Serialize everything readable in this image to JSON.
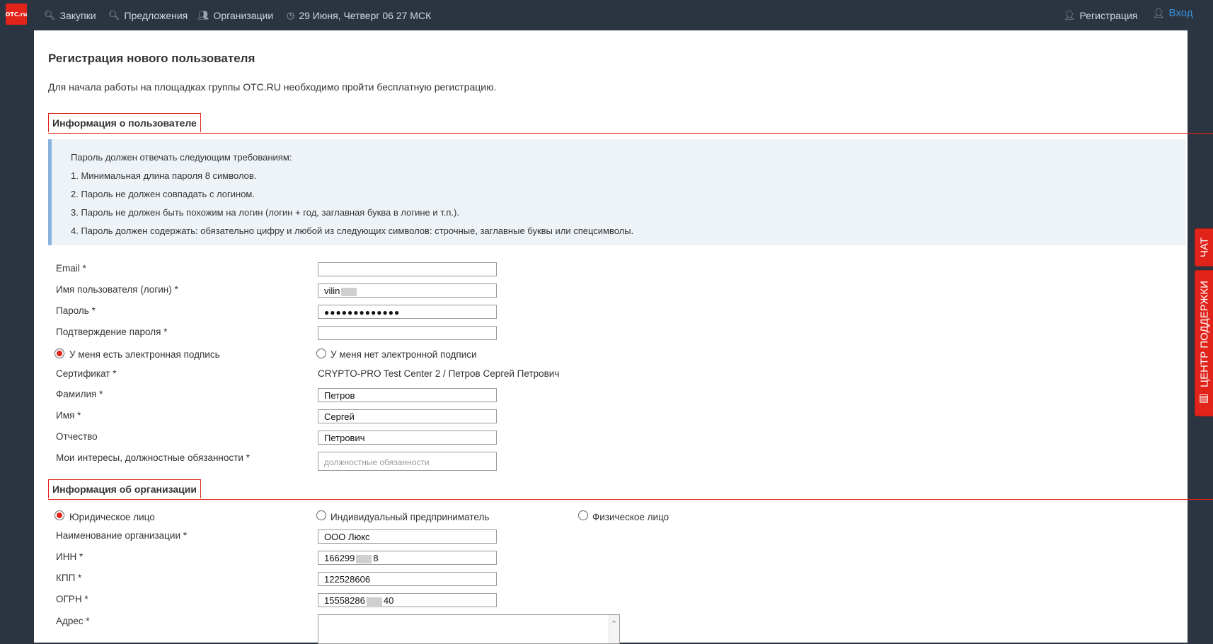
{
  "topbar": {
    "logo": "OTC.ru",
    "nav": [
      {
        "icon": "search-icon",
        "label": "Закупки"
      },
      {
        "icon": "search-icon",
        "label": "Предложения"
      },
      {
        "icon": "users-icon",
        "label": "Организации"
      },
      {
        "icon": "clock-icon",
        "label": "29 Июня, Четверг 06 27 МСК"
      }
    ],
    "register": {
      "icon": "user-plus-icon",
      "label": "Регистрация"
    },
    "login": {
      "icon": "user-icon",
      "label": "Вход"
    }
  },
  "page": {
    "title": "Регистрация нового пользователя",
    "intro": "Для начала работы на площадках группы OTC.RU необходимо пройти бесплатную регистрацию."
  },
  "user_section": {
    "header": "Информация о пользователе",
    "hint": {
      "lead": "Пароль должен отвечать следующим требованиям:",
      "items": [
        "1. Минимальная длина пароля 8 символов.",
        "2. Пароль не должен совпадать с логином.",
        "3. Пароль не должен быть похожим на логин (логин + год, заглавная буква в логине и т.п.).",
        "4. Пароль должен содержать: обязательно цифру и любой из следующих символов: строчные, заглавные буквы или спецсимволы."
      ]
    },
    "email": {
      "label": "Email *",
      "value": ""
    },
    "login": {
      "label": "Имя пользователя (логин) *",
      "value": "vilin"
    },
    "password": {
      "label": "Пароль *",
      "value": "●●●●●●●●●●●●●"
    },
    "password_confirm": {
      "label": "Подтверждение пароля *",
      "value": ""
    },
    "signature_yes": "У меня есть электронная подпись",
    "signature_no": "У меня нет электронной подписи",
    "certificate": {
      "label": "Сертификат *",
      "value": "CRYPTO-PRO Test Center 2 / Петров Сергей Петрович"
    },
    "last_name": {
      "label": "Фамилия *",
      "value": "Петров"
    },
    "first_name": {
      "label": "Имя *",
      "value": "Сергей"
    },
    "middle_name": {
      "label": "Отчество",
      "value": "Петрович"
    },
    "interests": {
      "label": "Мои интересы, должностные обязанности *",
      "placeholder": "должностные обязанности"
    }
  },
  "org_section": {
    "header": "Информация об организации",
    "type_legal": "Юридическое лицо",
    "type_ip": "Индивидуальный предприниматель",
    "type_person": "Физическое лицо",
    "org_name": {
      "label": "Наименование организации *",
      "value": "ООО Люкс"
    },
    "inn": {
      "label": "ИНН *",
      "value_start": "166299",
      "value_end": "8"
    },
    "kpp": {
      "label": "КПП *",
      "value": "122528606"
    },
    "ogrn": {
      "label": "ОГРН *",
      "value_start": "15558286",
      "value_end": "40"
    },
    "address": {
      "label": "Адрес *",
      "value": ""
    }
  },
  "side": {
    "chat": "ЧАТ",
    "support": "ЦЕНТР ПОДДЕРЖКИ"
  },
  "colors": {
    "accent": "#e2231a",
    "topbar": "#2b3542",
    "hint_bg": "#eef3f8",
    "hint_border": "#8bb2dc",
    "login_link": "#3a8fd8"
  }
}
